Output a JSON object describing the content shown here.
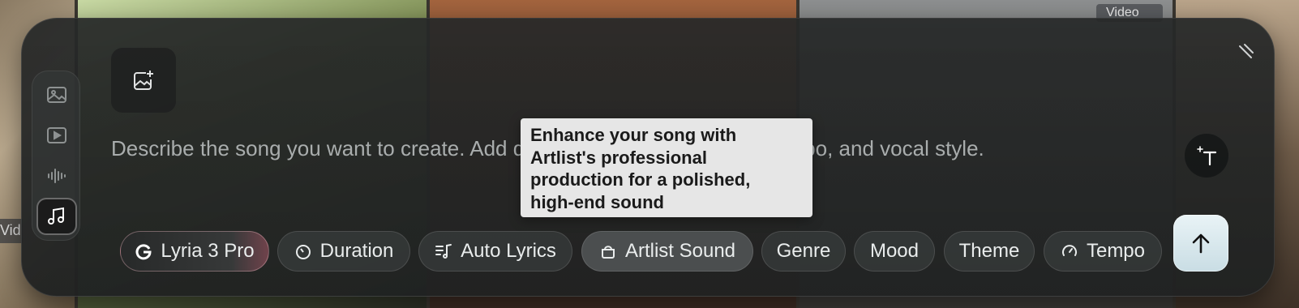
{
  "background": {
    "video_chip_label": "Video",
    "left_chip_label": "Vid"
  },
  "composer": {
    "prompt_placeholder": "Describe the song you want to create. Add details about genre, mood, tempo, and vocal style.",
    "modes": [
      {
        "name": "image-mode",
        "icon": "image-icon",
        "active": false
      },
      {
        "name": "video-mode",
        "icon": "play-icon",
        "active": false
      },
      {
        "name": "audio-mode",
        "icon": "waveform-icon",
        "active": false
      },
      {
        "name": "music-mode",
        "icon": "music-note-icon",
        "active": true
      }
    ],
    "chips": {
      "model": "Lyria 3 Pro",
      "duration": "Duration",
      "lyrics": "Auto Lyrics",
      "artlist_sound": "Artlist Sound",
      "genre": "Genre",
      "mood": "Mood",
      "theme": "Theme",
      "tempo": "Tempo"
    },
    "tooltip": {
      "line1": "Enhance your song with",
      "line2": "Artlist's professional",
      "line3": "production for a polished,",
      "line4": "high-end sound"
    },
    "send_icon": "arrow-up-icon",
    "upload_icon": "add-image-icon",
    "text_style_icon": "magic-text-icon",
    "collapse_icon": "collapse-icon"
  },
  "colors": {
    "panel": "#262828",
    "chip": "#343737",
    "send_button": "#d8e8ee",
    "tooltip_bg": "#e6e6e6"
  }
}
